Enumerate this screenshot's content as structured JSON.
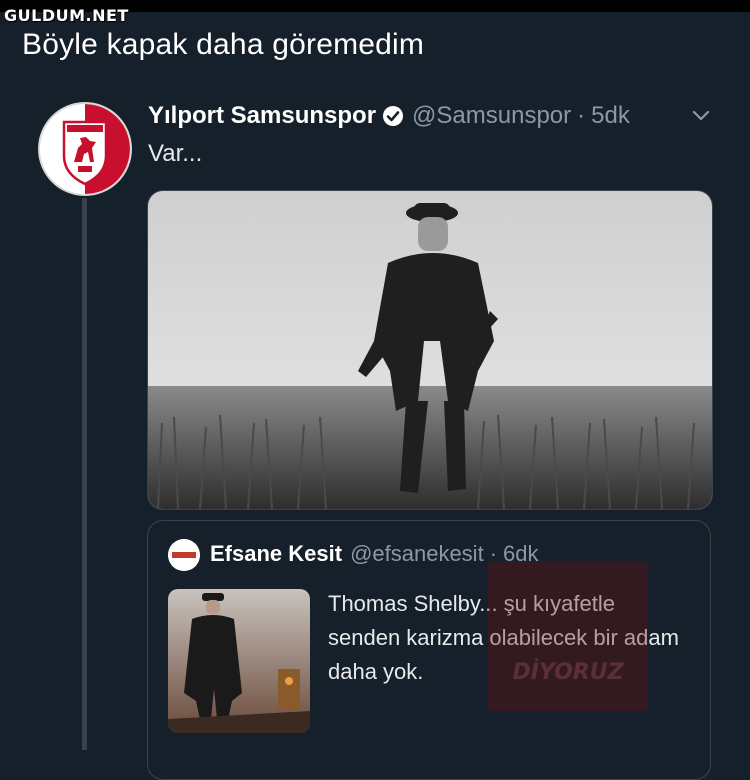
{
  "watermark": "GULDUM.NET",
  "caption": "Böyle kapak daha göremedim",
  "tweet": {
    "display_name": "Yılport Samsunspor",
    "handle": "@Samsunspor",
    "separator": "·",
    "time": "5dk",
    "text": "Var...",
    "avatar_icon": "samsunspor-logo",
    "verified_icon": "verified-badge-icon",
    "menu_icon": "chevron-down-icon"
  },
  "quote": {
    "display_name": "Efsane Kesit",
    "handle": "@efsanekesit",
    "separator": "·",
    "time": "6dk",
    "text": "Thomas Shelby... şu kıyafetle senden karizma olabilecek bir adam daha yok.",
    "stamp_text": "DİYORUZ"
  },
  "colors": {
    "background": "#15202b",
    "border": "#38444d",
    "muted": "#8b98a5",
    "club_red": "#c8102e"
  }
}
